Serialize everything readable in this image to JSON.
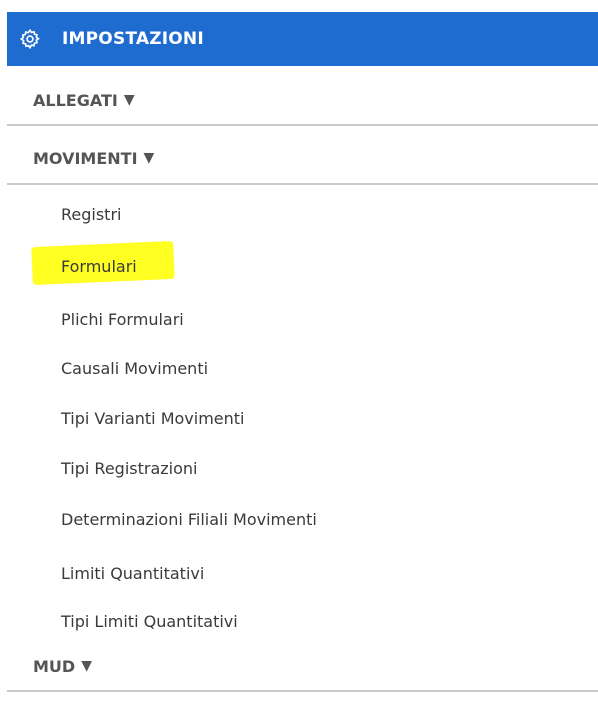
{
  "header": {
    "title": "IMPOSTAZIONI",
    "icon": "gear-icon",
    "background": "#1e6ccf"
  },
  "sections": {
    "allegati": {
      "label": "ALLEGATI",
      "arrow": "▼"
    },
    "movimenti": {
      "label": "MOVIMENTI",
      "arrow": "▼"
    },
    "mud": {
      "label": "MUD",
      "arrow": "▼"
    }
  },
  "items": [
    {
      "label": "Registri"
    },
    {
      "label": "Formulari",
      "highlight": "#ffff22"
    },
    {
      "label": "Plichi Formulari"
    },
    {
      "label": "Causali Movimenti"
    },
    {
      "label": "Tipi Varianti Movimenti"
    },
    {
      "label": "Tipi Registrazioni"
    },
    {
      "label": "Determinazioni Filiali Movimenti"
    },
    {
      "label": "Limiti Quantitativi"
    },
    {
      "label": "Tipi Limiti Quantitativi"
    }
  ]
}
